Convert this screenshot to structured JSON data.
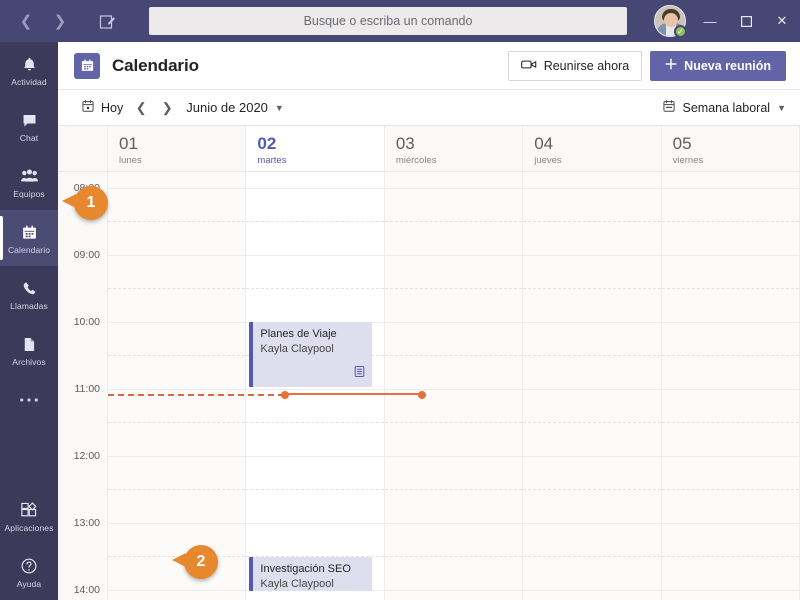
{
  "titlebar": {
    "back_icon": "chevron-left-icon",
    "forward_icon": "chevron-right-icon",
    "compose_icon": "compose-icon",
    "search_placeholder": "Busque o escriba un comando",
    "presence_status": "available",
    "minimize_label": "—",
    "maximize_label": "☐",
    "close_label": "✕"
  },
  "rail": {
    "items": [
      {
        "label": "Actividad",
        "icon": "bell-icon",
        "active": false
      },
      {
        "label": "Chat",
        "icon": "chat-icon",
        "active": false
      },
      {
        "label": "Equipos",
        "icon": "teams-icon",
        "active": false
      },
      {
        "label": "Calendario",
        "icon": "calendar-icon",
        "active": true
      },
      {
        "label": "Llamadas",
        "icon": "phone-icon",
        "active": false
      },
      {
        "label": "Archivos",
        "icon": "files-icon",
        "active": false
      },
      {
        "label": "",
        "icon": "ellipsis-icon",
        "active": false
      }
    ],
    "bottom_items": [
      {
        "label": "Aplicaciones",
        "icon": "apps-icon"
      },
      {
        "label": "Ayuda",
        "icon": "help-icon"
      }
    ]
  },
  "header": {
    "icon": "calendar-icon",
    "title": "Calendario",
    "meet_now_label": "Reunirse ahora",
    "meet_now_icon": "camera-icon",
    "new_meeting_label": "Nueva reunión",
    "new_meeting_icon": "plus-icon",
    "accent_color": "#6264a7"
  },
  "toolbar": {
    "today_label": "Hoy",
    "today_icon": "calendar-day-icon",
    "prev_icon": "chevron-left-icon",
    "next_icon": "chevron-right-icon",
    "month_label": "Junio de 2020",
    "month_caret": "chevron-down-icon",
    "view_label": "Semana laboral",
    "view_icon": "calendar-week-icon",
    "view_caret": "chevron-down-icon"
  },
  "calendar": {
    "days": [
      {
        "num": "01",
        "name": "lunes",
        "today": false
      },
      {
        "num": "02",
        "name": "martes",
        "today": true
      },
      {
        "num": "03",
        "name": "miércoles",
        "today": false
      },
      {
        "num": "04",
        "name": "jueves",
        "today": false
      },
      {
        "num": "05",
        "name": "viernes",
        "today": false
      }
    ],
    "hours": [
      "08:00",
      "09:00",
      "10:00",
      "11:00",
      "12:00",
      "13:00",
      "14:00"
    ],
    "today_color": "#5558af",
    "now_indicator_color": "#e8703a",
    "events": [
      {
        "title": "Planes de Viaje",
        "organizer": "Kayla Claypool",
        "day_index": 1,
        "start": "10:00",
        "end": "11:00",
        "badge_icon": "teams-meeting-icon",
        "bg_color": "#dedeef",
        "accent_color": "#5558af"
      },
      {
        "title": "Investigación SEO",
        "organizer": "Kayla Claypool",
        "day_index": 1,
        "start": "13:30",
        "end": "14:00",
        "badge_icon": "",
        "bg_color": "#dedeef",
        "accent_color": "#5558af"
      }
    ]
  },
  "callouts": [
    {
      "number": "1",
      "target": "sidebar-item-calendario"
    },
    {
      "number": "2",
      "target": "event-investigacion-seo"
    }
  ]
}
